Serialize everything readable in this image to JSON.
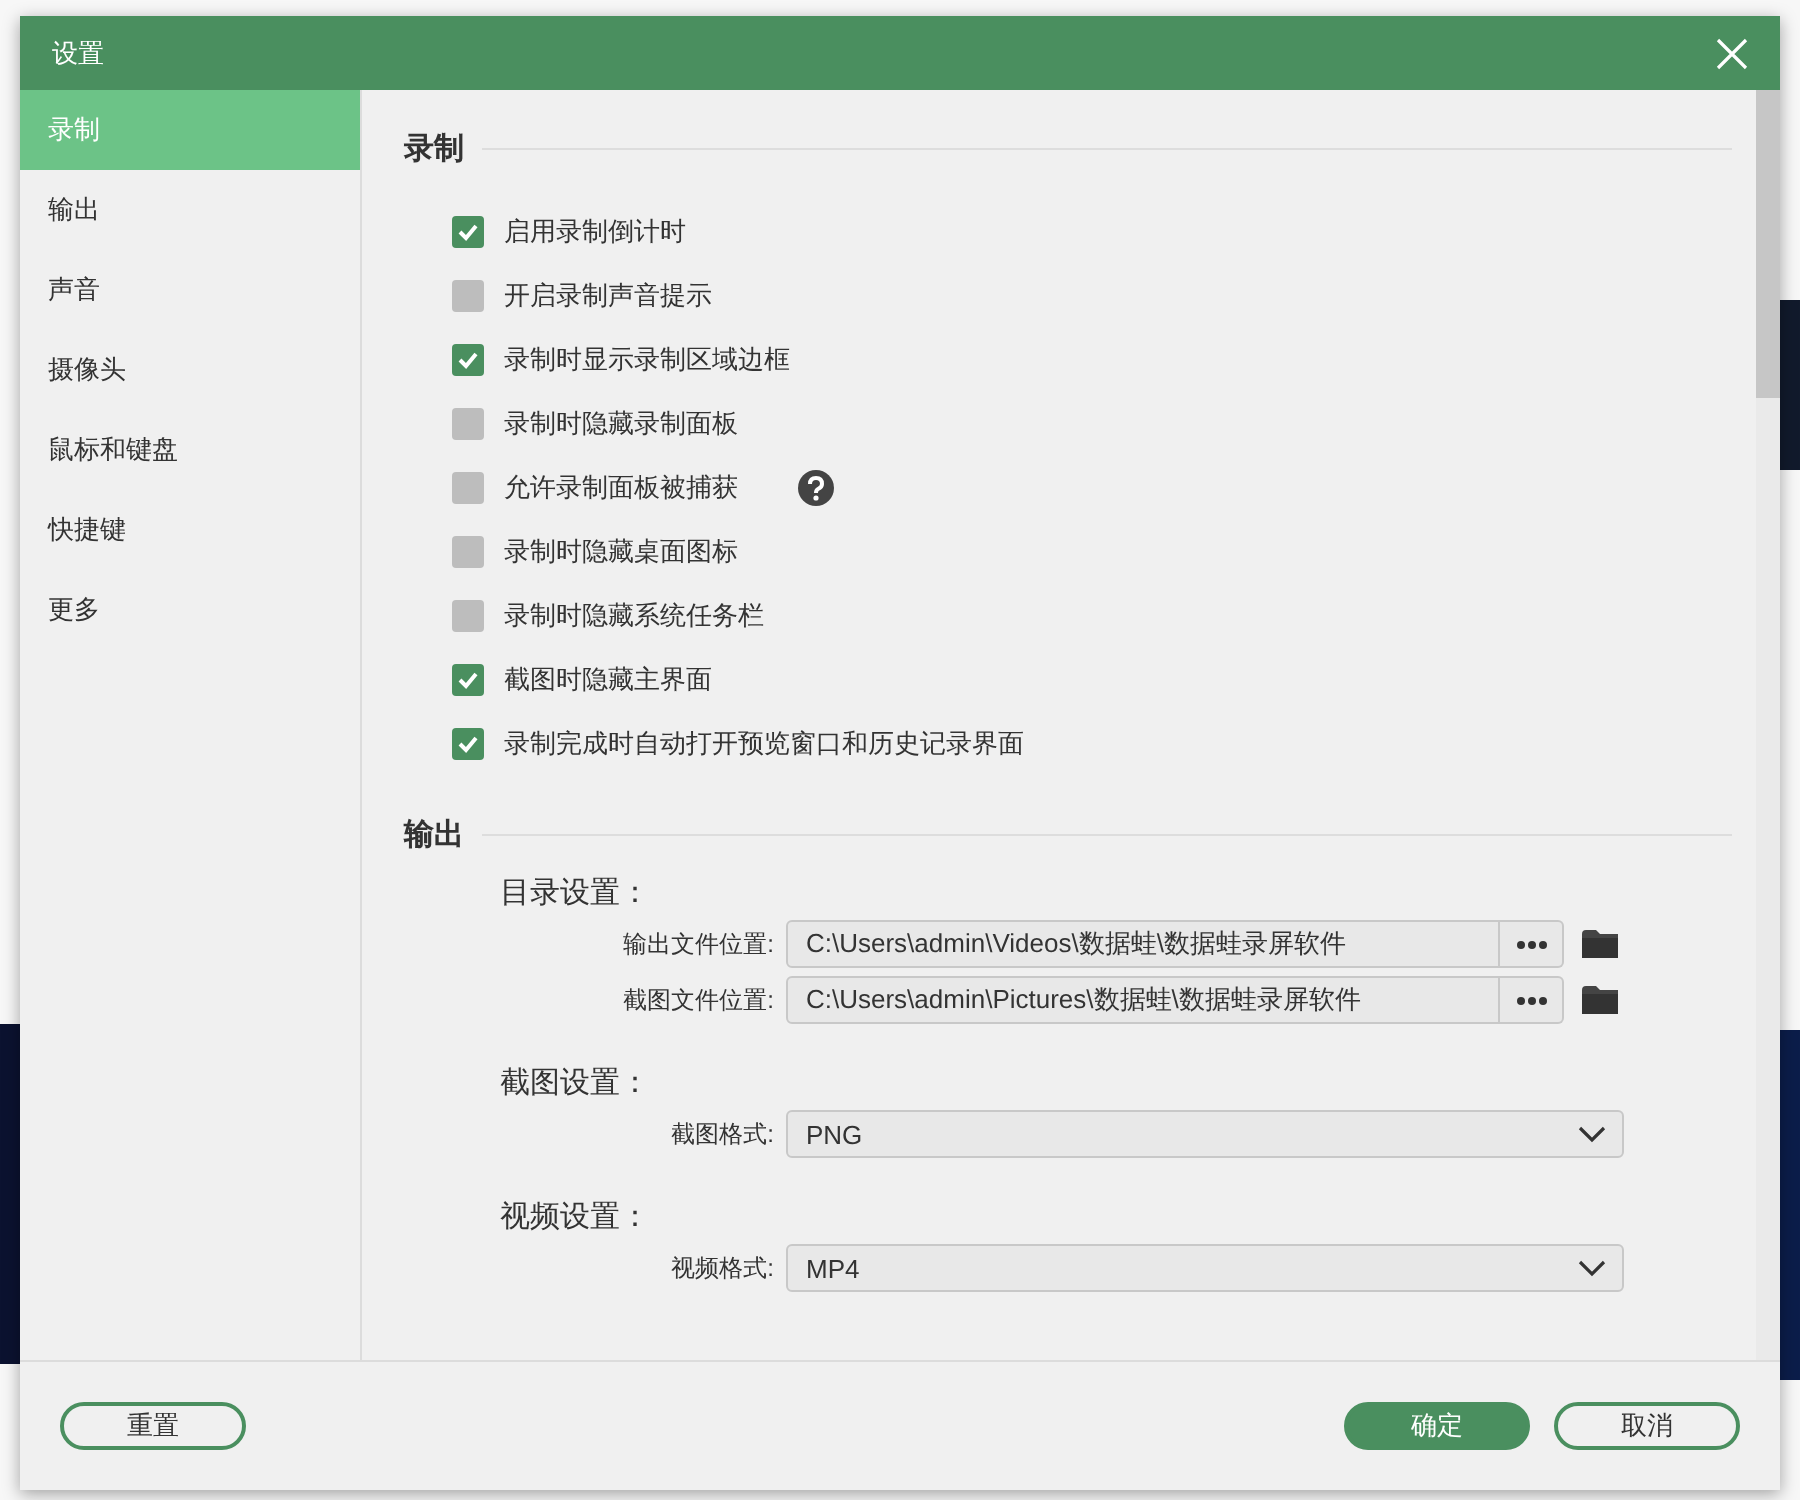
{
  "window": {
    "title": "设置"
  },
  "sidebar": {
    "items": [
      {
        "label": "录制",
        "selected": true
      },
      {
        "label": "输出",
        "selected": false
      },
      {
        "label": "声音",
        "selected": false
      },
      {
        "label": "摄像头",
        "selected": false
      },
      {
        "label": "鼠标和键盘",
        "selected": false
      },
      {
        "label": "快捷键",
        "selected": false
      },
      {
        "label": "更多",
        "selected": false
      }
    ]
  },
  "recording": {
    "title": "录制",
    "options": [
      {
        "label": "启用录制倒计时",
        "checked": true
      },
      {
        "label": "开启录制声音提示",
        "checked": false
      },
      {
        "label": "录制时显示录制区域边框",
        "checked": true
      },
      {
        "label": "录制时隐藏录制面板",
        "checked": false
      },
      {
        "label": "允许录制面板被捕获",
        "checked": false,
        "help": true
      },
      {
        "label": "录制时隐藏桌面图标",
        "checked": false
      },
      {
        "label": "录制时隐藏系统任务栏",
        "checked": false
      },
      {
        "label": "截图时隐藏主界面",
        "checked": true
      },
      {
        "label": "录制完成时自动打开预览窗口和历史记录界面",
        "checked": true
      }
    ]
  },
  "output": {
    "title": "输出",
    "groups": [
      {
        "title": "目录设置：",
        "rows": [
          {
            "kind": "path",
            "label": "输出文件位置:",
            "value": "C:\\Users\\admin\\Videos\\数据蛙\\数据蛙录屏软件"
          },
          {
            "kind": "path",
            "label": "截图文件位置:",
            "value": "C:\\Users\\admin\\Pictures\\数据蛙\\数据蛙录屏软件"
          }
        ]
      },
      {
        "title": "截图设置：",
        "rows": [
          {
            "kind": "select",
            "label": "截图格式:",
            "value": "PNG"
          }
        ]
      },
      {
        "title": "视频设置：",
        "rows": [
          {
            "kind": "select",
            "label": "视频格式:",
            "value": "MP4"
          }
        ]
      }
    ]
  },
  "footer": {
    "reset": {
      "label": "重置",
      "kind": "outline"
    },
    "buttons": [
      {
        "label": "确定",
        "kind": "primary"
      },
      {
        "label": "取消",
        "kind": "outline"
      }
    ]
  }
}
